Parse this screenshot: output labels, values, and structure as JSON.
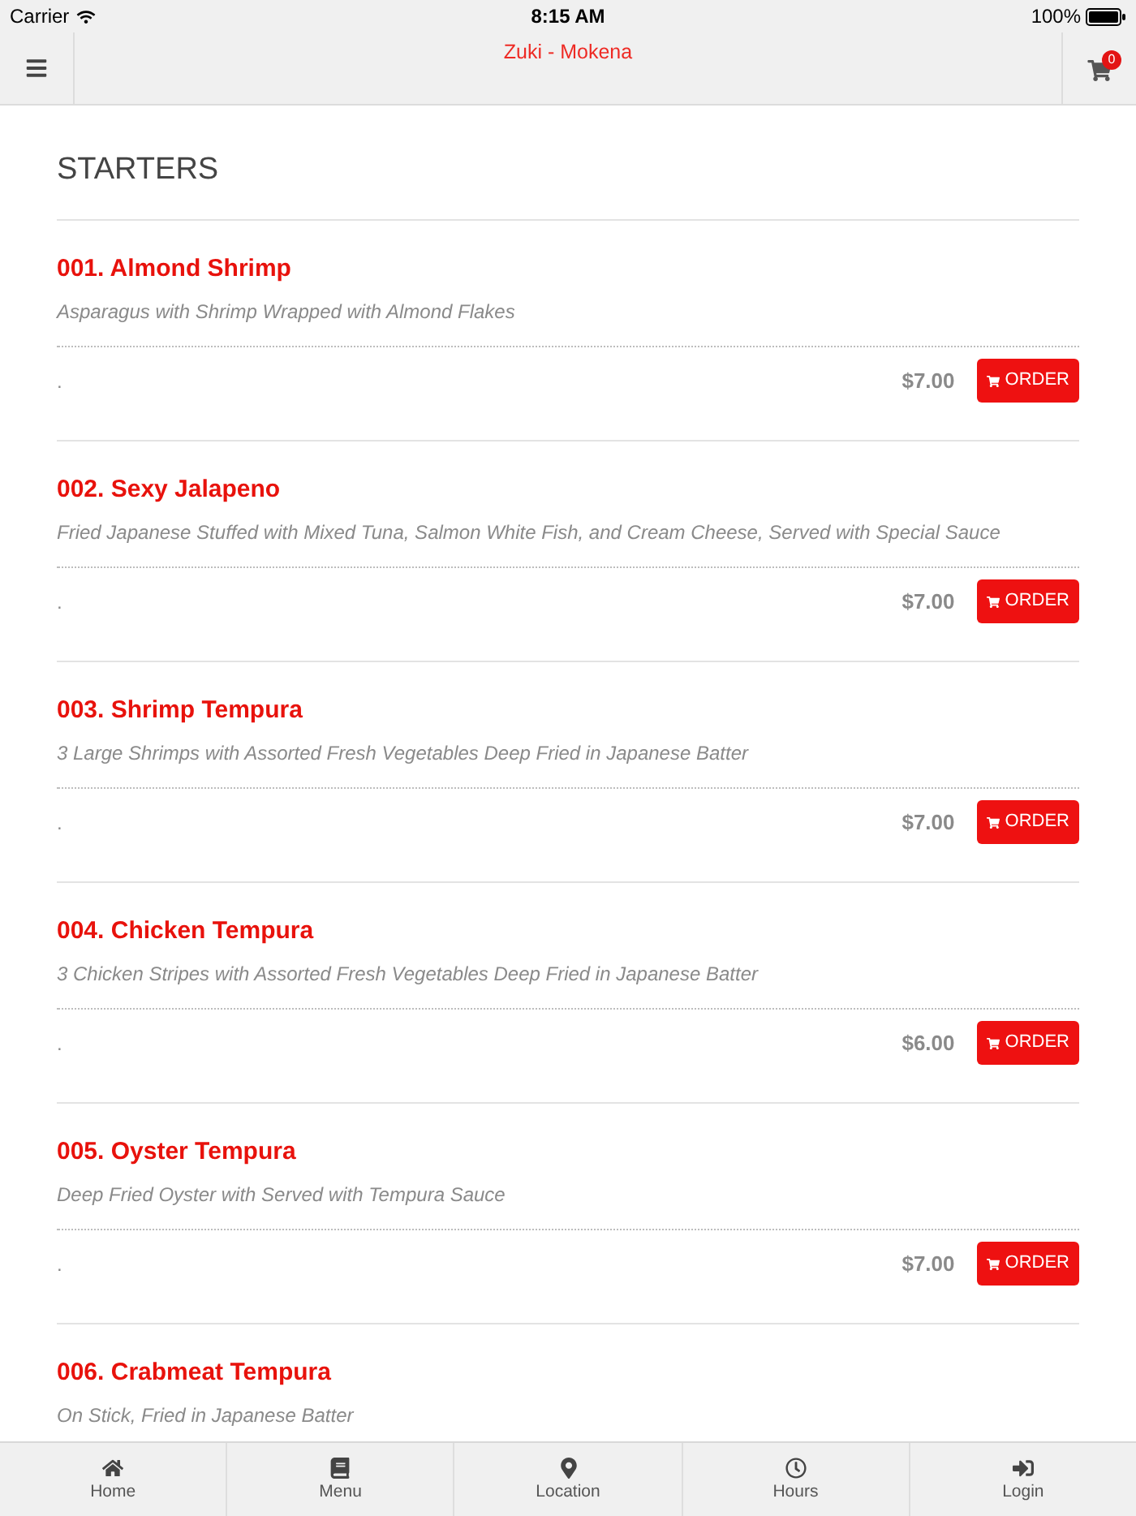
{
  "status_bar": {
    "carrier": "Carrier",
    "time": "8:15 AM",
    "battery": "100%"
  },
  "header": {
    "title": "Zuki - Mokena",
    "cart_count": "0"
  },
  "section": {
    "heading": "STARTERS"
  },
  "items": [
    {
      "name": "001. Almond Shrimp",
      "description": "Asparagus with Shrimp Wrapped with Almond Flakes",
      "note": ".",
      "price": "$7.00",
      "button": "ORDER"
    },
    {
      "name": "002. Sexy Jalapeno",
      "description": "Fried Japanese Stuffed with Mixed Tuna, Salmon White Fish, and Cream Cheese, Served with Special Sauce",
      "note": ".",
      "price": "$7.00",
      "button": "ORDER"
    },
    {
      "name": "003. Shrimp Tempura",
      "description": "3 Large Shrimps with Assorted Fresh Vegetables Deep Fried in Japanese Batter",
      "note": ".",
      "price": "$7.00",
      "button": "ORDER"
    },
    {
      "name": "004. Chicken Tempura",
      "description": "3 Chicken Stripes with Assorted Fresh Vegetables Deep Fried in Japanese Batter",
      "note": ".",
      "price": "$6.00",
      "button": "ORDER"
    },
    {
      "name": "005. Oyster Tempura",
      "description": "Deep Fried Oyster with Served with Tempura Sauce",
      "note": ".",
      "price": "$7.00",
      "button": "ORDER"
    },
    {
      "name": "006. Crabmeat Tempura",
      "description": "On Stick, Fried in Japanese Batter"
    }
  ],
  "tab_bar": [
    {
      "kind": "home",
      "label": "Home"
    },
    {
      "kind": "menu",
      "label": "Menu"
    },
    {
      "kind": "location",
      "label": "Location"
    },
    {
      "kind": "hours",
      "label": "Hours"
    },
    {
      "kind": "login",
      "label": "Login"
    }
  ]
}
